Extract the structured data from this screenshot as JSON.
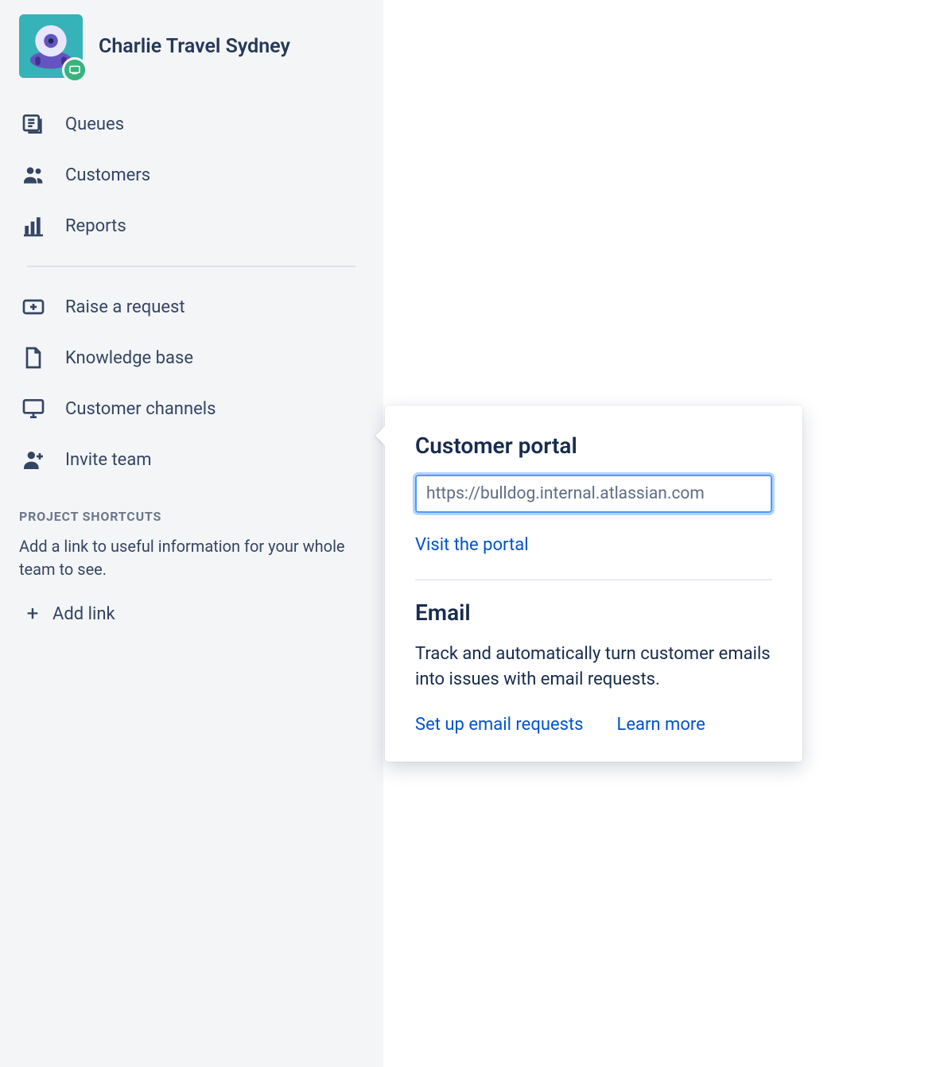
{
  "project": {
    "title": "Charlie Travel Sydney"
  },
  "sidebar": {
    "items": [
      {
        "label": "Queues",
        "icon": "queues"
      },
      {
        "label": "Customers",
        "icon": "customers"
      },
      {
        "label": "Reports",
        "icon": "reports"
      }
    ],
    "secondary": [
      {
        "label": "Raise a request",
        "icon": "raise"
      },
      {
        "label": "Knowledge base",
        "icon": "kb"
      },
      {
        "label": "Customer channels",
        "icon": "channels"
      },
      {
        "label": "Invite team",
        "icon": "invite"
      }
    ],
    "shortcuts_heading": "PROJECT SHORTCUTS",
    "shortcuts_desc": "Add a link to useful information for your whole team to see.",
    "add_link_label": "Add link"
  },
  "popover": {
    "portal_heading": "Customer portal",
    "portal_url": "https://bulldog.internal.atlassian.com",
    "visit_link": "Visit the portal",
    "email_heading": "Email",
    "email_desc": "Track and automatically turn customer emails into issues with email requests.",
    "setup_link": "Set up email requests",
    "learn_link": "Learn more"
  }
}
